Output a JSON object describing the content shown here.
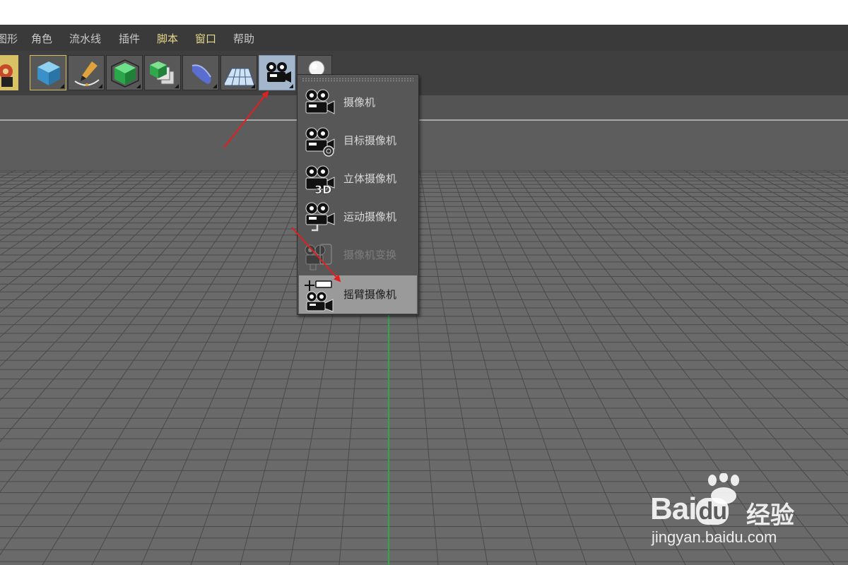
{
  "menu": {
    "items": [
      {
        "label": "图形",
        "highlight": false
      },
      {
        "label": "角色",
        "highlight": false
      },
      {
        "label": "流水线",
        "highlight": false
      },
      {
        "label": "插件",
        "highlight": false
      },
      {
        "label": "脚本",
        "highlight": true
      },
      {
        "label": "窗口",
        "highlight": true
      },
      {
        "label": "帮助",
        "highlight": false
      }
    ]
  },
  "toolbar": {
    "buttons": [
      {
        "icon": "cube-icon"
      },
      {
        "icon": "pen-spline-icon"
      },
      {
        "icon": "subdivision-cube-icon"
      },
      {
        "icon": "array-cubes-icon"
      },
      {
        "icon": "deformer-icon"
      },
      {
        "icon": "floor-plane-icon"
      },
      {
        "icon": "camera-icon",
        "selected": true
      },
      {
        "icon": "light-icon"
      }
    ]
  },
  "camera_menu": {
    "items": [
      {
        "label": "摄像机",
        "icon": "camera-icon",
        "state": "normal"
      },
      {
        "label": "目标摄像机",
        "icon": "target-camera-icon",
        "state": "normal"
      },
      {
        "label": "立体摄像机",
        "icon": "stereo-camera-icon",
        "state": "normal"
      },
      {
        "label": "运动摄像机",
        "icon": "motion-camera-icon",
        "state": "normal"
      },
      {
        "label": "摄像机变换",
        "icon": "camera-morph-icon",
        "state": "disabled"
      },
      {
        "label": "摇臂摄像机",
        "icon": "crane-camera-icon",
        "state": "active"
      }
    ],
    "stereo_badge": "3D"
  },
  "watermark": {
    "brand": "Bai",
    "brand_du": "du",
    "sub": "经验",
    "url": "jingyan.baidu.com"
  },
  "colors": {
    "menubar": "#3a3a3a",
    "toolbar": "#3f3f3f",
    "viewport": "#5c5c5c",
    "selected_button": "#a4b6cc",
    "arrow": "#e02020",
    "axis_y": "#2fa84a"
  }
}
